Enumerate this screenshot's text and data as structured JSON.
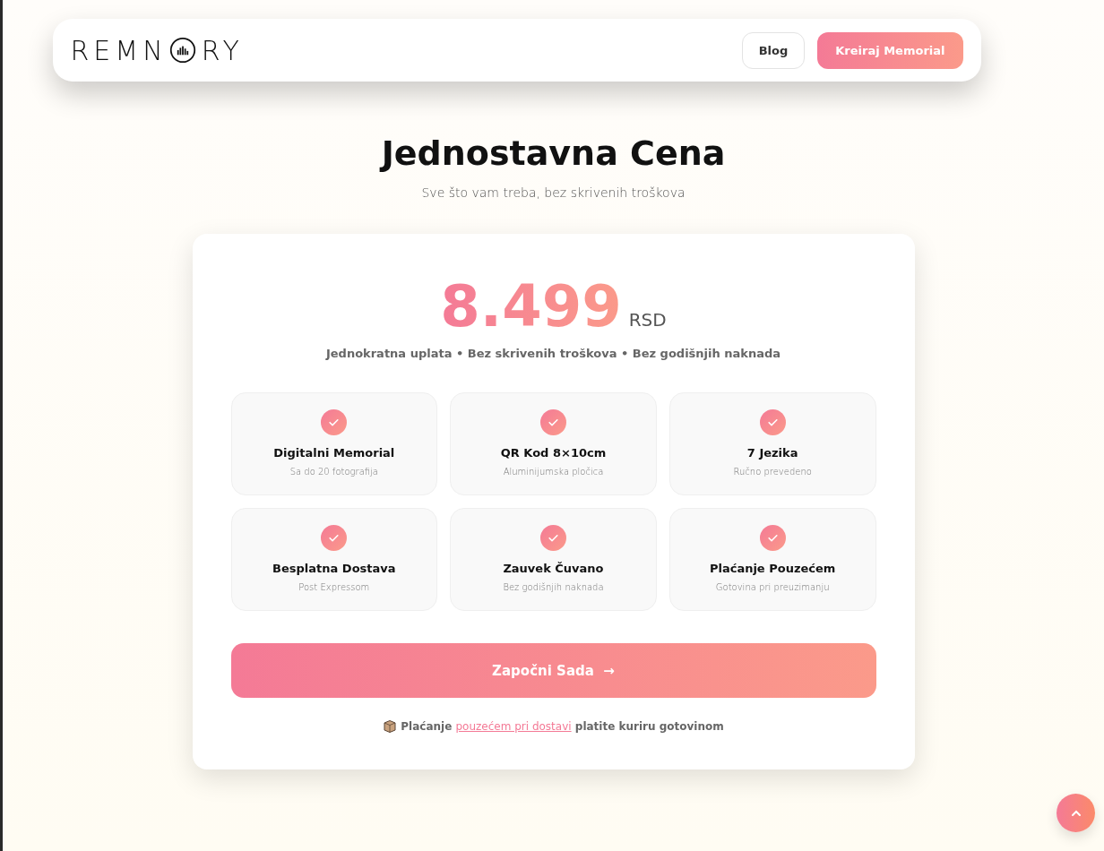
{
  "nav": {
    "logo_start": "REMN",
    "logo_end": "RY",
    "buttons": [
      {
        "label": "Blog",
        "kind": "outline"
      },
      {
        "label": "Kreiraj Memorial",
        "kind": "primary"
      }
    ]
  },
  "hero": {
    "title": "Jednostavna Cena",
    "subtitle": "Sve što vam treba, bez skrivenih troškova"
  },
  "pricing": {
    "amount": "8.499",
    "currency": "RSD",
    "note": "Jednokratna uplata • Bez skrivenih troškova • Bez godišnjih naknada",
    "features": [
      {
        "title": "Digitalni Memorial",
        "detail": "Sa do 20 fotografija"
      },
      {
        "title": "QR Kod 8×10cm",
        "detail": "Aluminijumska pločica"
      },
      {
        "title": "7 Jezika",
        "detail": "Ručno prevedeno"
      },
      {
        "title": "Besplatna Dostava",
        "detail": "Post Expressom"
      },
      {
        "title": "Zauvek Čuvano",
        "detail": "Bez godišnjih naknada"
      },
      {
        "title": "Plaćanje Pouzećem",
        "detail": "Gotovina pri preuzimanju"
      }
    ],
    "cta": "Započni Sada",
    "cta_arrow": "→",
    "payment_note": {
      "before": "Plaćanje",
      "link": "pouzećem pri dostavi",
      "after": "platite kuriru gotovinom"
    }
  }
}
